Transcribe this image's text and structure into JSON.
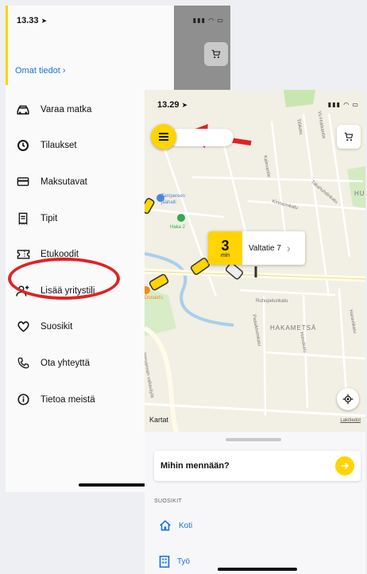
{
  "left_screen": {
    "status_time": "13.33",
    "profile_link": "Omat tiedot",
    "profile_chevron": "›",
    "menu": [
      {
        "label": "Varaa matka",
        "icon": "car-icon"
      },
      {
        "label": "Tilaukset",
        "icon": "history-icon"
      },
      {
        "label": "Maksutavat",
        "icon": "credit-card-icon"
      },
      {
        "label": "Tipit",
        "icon": "receipt-icon"
      },
      {
        "label": "Etukoodit",
        "icon": "ticket-icon"
      },
      {
        "label": "Lisää yritystili",
        "icon": "add-person-icon"
      },
      {
        "label": "Suosikit",
        "icon": "heart-icon"
      },
      {
        "label": "Ota yhteyttä",
        "icon": "phone-icon"
      },
      {
        "label": "Tietoa meistä",
        "icon": "info-icon"
      }
    ]
  },
  "right_screen": {
    "status_time": "13.29",
    "eta": {
      "minutes": "3",
      "unit": "min",
      "address": "Valtatie 7"
    },
    "map_labels": {
      "place_1": "Tampereen",
      "place_1b": "jäähalli",
      "place_2": "Haka 2",
      "district_1": "HAKAMETSÄ",
      "district_2": "HUI",
      "place_3": "Donald's",
      "road_1": "Hervannan valtaväylä",
      "road_2": "Kinnarinkatu",
      "road_3": "Takahuhdinkatu",
      "road_4": "Ruhupelunkatu",
      "road_5": "Paasikivenkatu",
      "road_6": "Kalevantie",
      "road_7": "Tiilikatu",
      "road_8": "Yli-Hukkantie",
      "road_9": "Hoivakatu",
      "road_10": "Haraviikatu"
    },
    "map_brand": "Kartat",
    "legal": "Lakitiedot",
    "search_label": "Mihin mennään?",
    "favorites_header": "SUOSIKIT",
    "favorites": [
      {
        "label": "Koti",
        "icon": "home-icon"
      },
      {
        "label": "Työ",
        "icon": "building-icon"
      }
    ]
  },
  "colors": {
    "accent_yellow": "#ffd400",
    "link_blue": "#1a73d9",
    "annotation_red": "#e02222"
  }
}
